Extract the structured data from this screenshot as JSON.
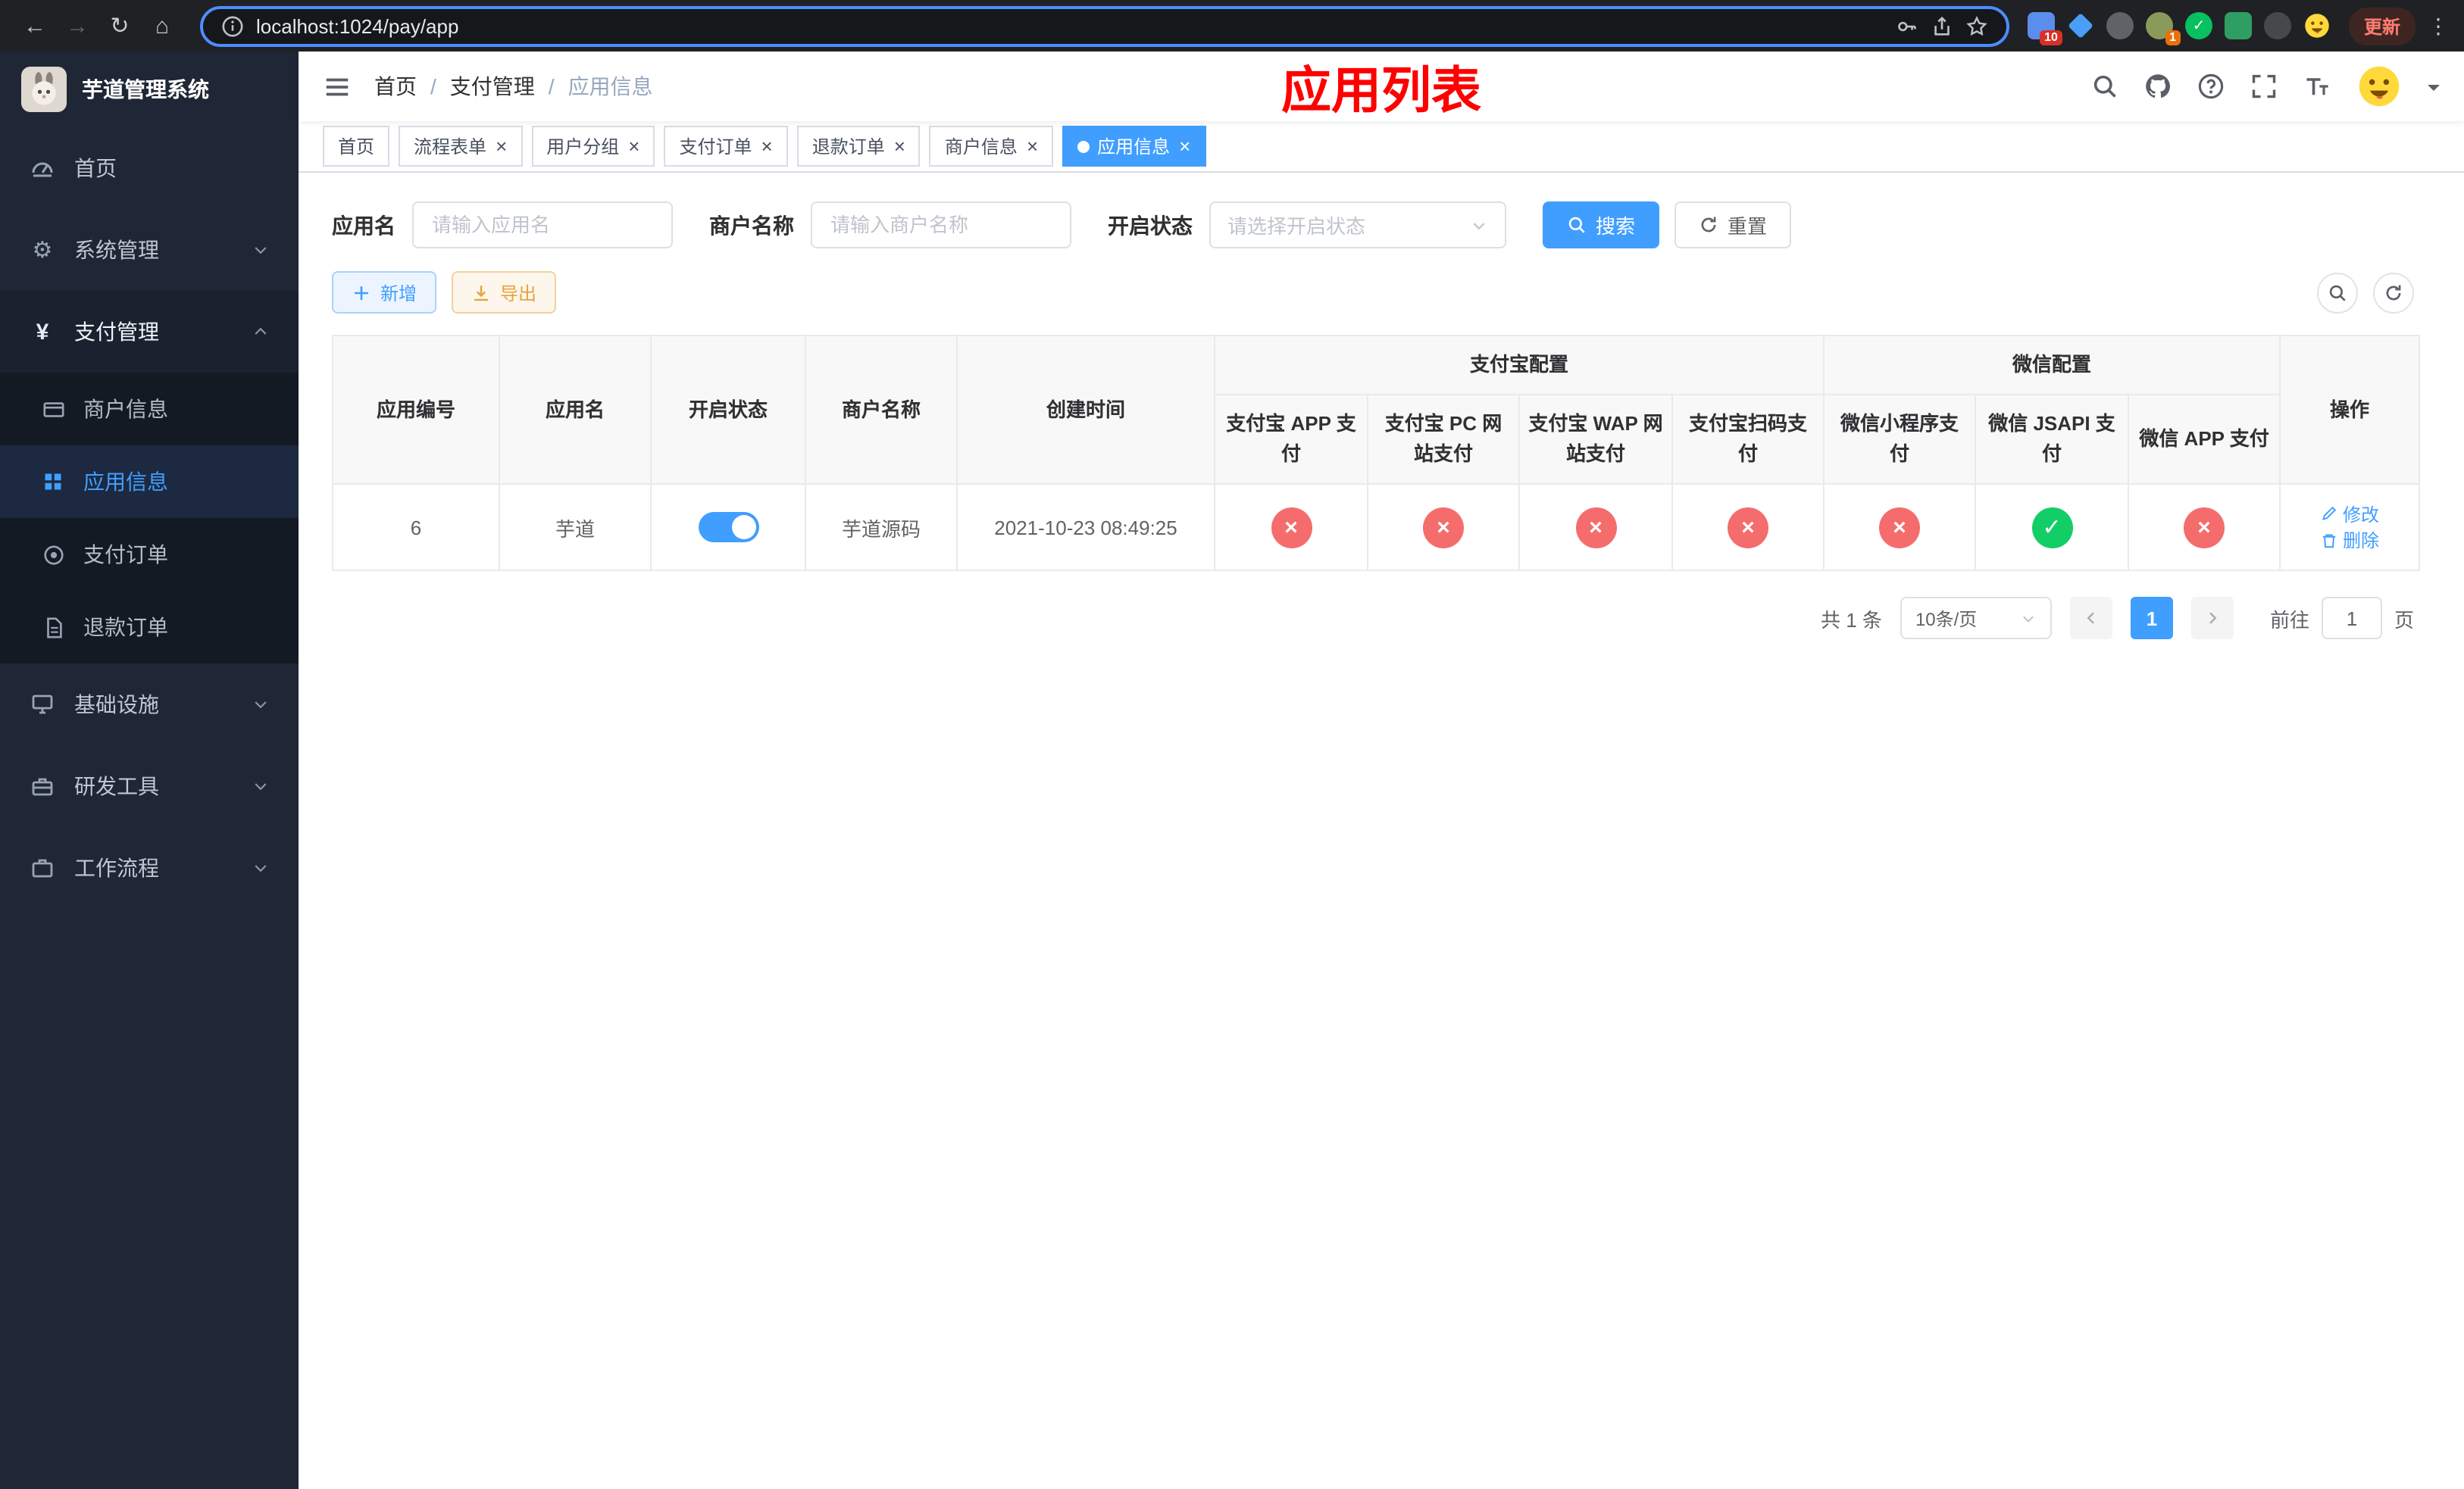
{
  "colors": {
    "accent": "#409eff",
    "danger": "#f56c6c",
    "success": "#13ce66",
    "warning": "#e6a23c",
    "annotation_red": "#ff0000"
  },
  "icons": {
    "back": "←",
    "forward": "→",
    "reload": "↻",
    "home": "⌂",
    "dots": "⋮",
    "gear": "⚙",
    "yen": "¥",
    "close": "×",
    "slash": "/",
    "check": "✓",
    "cross": "×"
  },
  "browser": {
    "url": "localhost:1024/pay/app",
    "update_label": "更新",
    "ext_badge_blocks": "10",
    "ext_badge_avatar": "1"
  },
  "sidebar": {
    "title": "芋道管理系统",
    "items": [
      {
        "label": "首页"
      },
      {
        "label": "系统管理"
      },
      {
        "label": "支付管理"
      },
      {
        "label": "基础设施"
      },
      {
        "label": "研发工具"
      },
      {
        "label": "工作流程"
      }
    ],
    "submenu_items": [
      {
        "label": "商户信息"
      },
      {
        "label": "应用信息"
      },
      {
        "label": "支付订单"
      },
      {
        "label": "退款订单"
      }
    ]
  },
  "navbar": {
    "breadcrumb": [
      "首页",
      "支付管理",
      "应用信息"
    ],
    "overlay_title": "应用列表"
  },
  "tabs": [
    {
      "label": "首页"
    },
    {
      "label": "流程表单"
    },
    {
      "label": "用户分组"
    },
    {
      "label": "支付订单"
    },
    {
      "label": "退款订单"
    },
    {
      "label": "商户信息"
    },
    {
      "label": "应用信息"
    }
  ],
  "filters": {
    "app_name_label": "应用名",
    "app_name_placeholder": "请输入应用名",
    "merchant_label": "商户名称",
    "merchant_placeholder": "请输入商户名称",
    "status_label": "开启状态",
    "status_placeholder": "请选择开启状态",
    "search_label": "搜索",
    "reset_label": "重置"
  },
  "actions": {
    "add_label": "新增",
    "export_label": "导出"
  },
  "table": {
    "headers": {
      "id": "应用编号",
      "name": "应用名",
      "status": "开启状态",
      "merchant": "商户名称",
      "created": "创建时间",
      "ops": "操作"
    },
    "group_alipay": "支付宝配置",
    "group_wechat": "微信配置",
    "sub_headers": [
      "支付宝 APP 支付",
      "支付宝 PC 网站支付",
      "支付宝 WAP 网站支付",
      "支付宝扫码支付",
      "微信小程序支付",
      "微信 JSAPI 支付",
      "微信 APP 支付"
    ],
    "rows": [
      {
        "id": "6",
        "name": "芋道",
        "enabled": true,
        "merchant": "芋道源码",
        "created": "2021-10-23 08:49:25",
        "channels": [
          false,
          false,
          false,
          false,
          false,
          true,
          false
        ],
        "edit_label": "修改",
        "delete_label": "删除"
      }
    ]
  },
  "pagination": {
    "total": "共 1 条",
    "page_size": "10条/页",
    "pages": [
      "1"
    ],
    "goto_label": "前往",
    "goto_value": "1",
    "goto_unit": "页"
  }
}
